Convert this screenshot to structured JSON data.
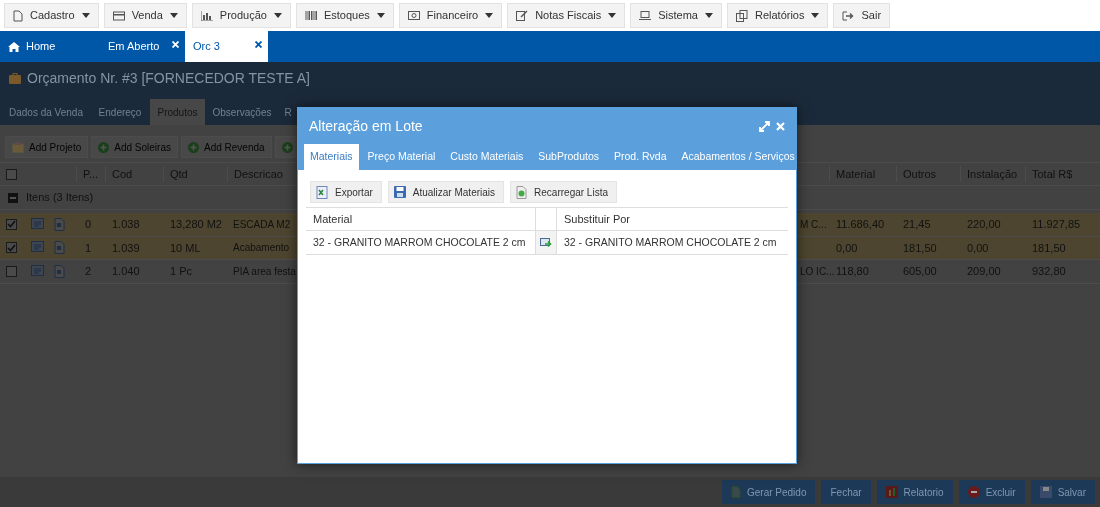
{
  "menu": [
    {
      "label": "Cadastro",
      "dropdown": true
    },
    {
      "label": "Venda",
      "dropdown": true
    },
    {
      "label": "Produção",
      "dropdown": true
    },
    {
      "label": "Estoques",
      "dropdown": true
    },
    {
      "label": "Financeiro",
      "dropdown": true
    },
    {
      "label": "Notas Fiscais",
      "dropdown": true
    },
    {
      "label": "Sistema",
      "dropdown": true
    },
    {
      "label": "Relatórios",
      "dropdown": true
    },
    {
      "label": "Sair",
      "dropdown": false
    }
  ],
  "tabs": [
    {
      "label": "Home",
      "selected": false,
      "closable": false
    },
    {
      "label": "Em Aberto",
      "selected": false,
      "closable": true
    },
    {
      "label": "Orc 3",
      "selected": true,
      "closable": true
    }
  ],
  "page": {
    "title": "Orçamento Nr. #3 [FORNECEDOR TESTE A]",
    "section_tabs": [
      {
        "label": "Dados da Venda",
        "selected": false
      },
      {
        "label": "Endereço",
        "selected": false
      },
      {
        "label": "Produtos",
        "selected": true
      },
      {
        "label": "Observações",
        "selected": false
      },
      {
        "label": "R",
        "selected": false
      }
    ],
    "toolbar": [
      {
        "kind": "labeled",
        "label": "Add Projeto"
      },
      {
        "kind": "labeled",
        "label": "Add Soleiras"
      },
      {
        "kind": "labeled",
        "label": "Add Revenda"
      },
      {
        "kind": "icon"
      }
    ],
    "table": {
      "all_checked": false,
      "columns": [
        "P...",
        "Cod",
        "Qtd",
        "Descricao",
        "Material",
        "Outros",
        "Instalação",
        "Total R$"
      ],
      "group": {
        "label": "Itens (3 Itens)",
        "expanded": true
      },
      "rows": [
        {
          "checked": true,
          "p": "0",
          "cod": "1.038",
          "qtd": "13,280 M2",
          "descricao": "ESCADA M2",
          "column_7": "M C...",
          "material": "11.686,40",
          "outros": "21,45",
          "instalacao": "220,00",
          "total": "11.927,85"
        },
        {
          "checked": true,
          "p": "1",
          "cod": "1.039",
          "qtd": "10 ML",
          "descricao": "Acabamento",
          "material": "0,00",
          "outros": "181,50",
          "instalacao": "0,00",
          "total": "181,50"
        },
        {
          "checked": false,
          "p": "2",
          "cod": "1.040",
          "qtd": "1 Pc",
          "descricao": "PIA area festa",
          "column_7": "LO IC...",
          "material": "118,80",
          "outros": "605,00",
          "instalacao": "209,00",
          "total": "932,80"
        }
      ]
    },
    "footer_buttons": [
      "Gerar Pedido",
      "Fechar",
      "Relatorio",
      "Excluir",
      "Salvar"
    ]
  },
  "modal": {
    "title": "Alteração em Lote",
    "tabs": [
      {
        "label": "Materiais",
        "selected": true
      },
      {
        "label": "Preço Material",
        "selected": false
      },
      {
        "label": "Custo Materiais",
        "selected": false
      },
      {
        "label": "SubProdutos",
        "selected": false
      },
      {
        "label": "Prod. Rvda",
        "selected": false
      },
      {
        "label": "Acabamentos / Serviços",
        "selected": false
      }
    ],
    "toolbar": [
      "Exportar",
      "Atualizar Materiais",
      "Recarregar Lista"
    ],
    "columns": [
      "Material",
      "Substituir Por"
    ],
    "rows": [
      {
        "material": "32 - GRANITO MARROM CHOCOLATE 2 cm",
        "substituir": "32 - GRANITO MARROM CHOCOLATE 2 cm"
      }
    ]
  }
}
